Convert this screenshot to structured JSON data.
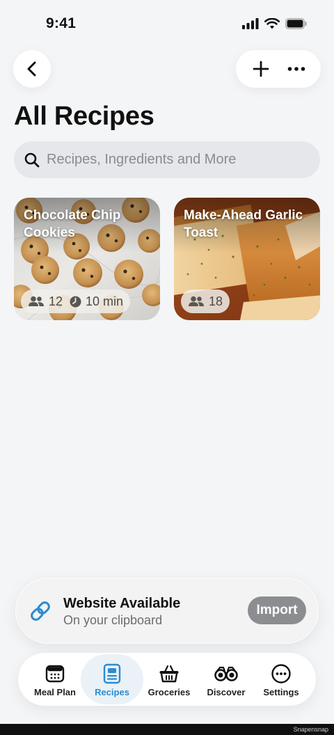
{
  "status_bar": {
    "time": "9:41"
  },
  "header": {
    "title": "All Recipes"
  },
  "search": {
    "placeholder": "Recipes, Ingredients and More"
  },
  "recipes": [
    {
      "name": "Chocolate Chip Cookies",
      "servings": "12",
      "time": "10 min"
    },
    {
      "name": "Make-Ahead Garlic Toast",
      "servings": "18"
    }
  ],
  "clipboard_banner": {
    "title": "Website Available",
    "subtitle": "On your clipboard",
    "button": "Import"
  },
  "tabs": [
    {
      "label": "Meal Plan",
      "icon": "calendar-icon"
    },
    {
      "label": "Recipes",
      "icon": "recipe-card-icon",
      "active": true
    },
    {
      "label": "Groceries",
      "icon": "basket-icon"
    },
    {
      "label": "Discover",
      "icon": "binoculars-icon"
    },
    {
      "label": "Settings",
      "icon": "ellipsis-circle-icon"
    }
  ],
  "watermark": "Snapensnap",
  "colors": {
    "accent": "#2a8bd0",
    "background": "#f4f5f7",
    "import_button": "#8c8d90"
  }
}
